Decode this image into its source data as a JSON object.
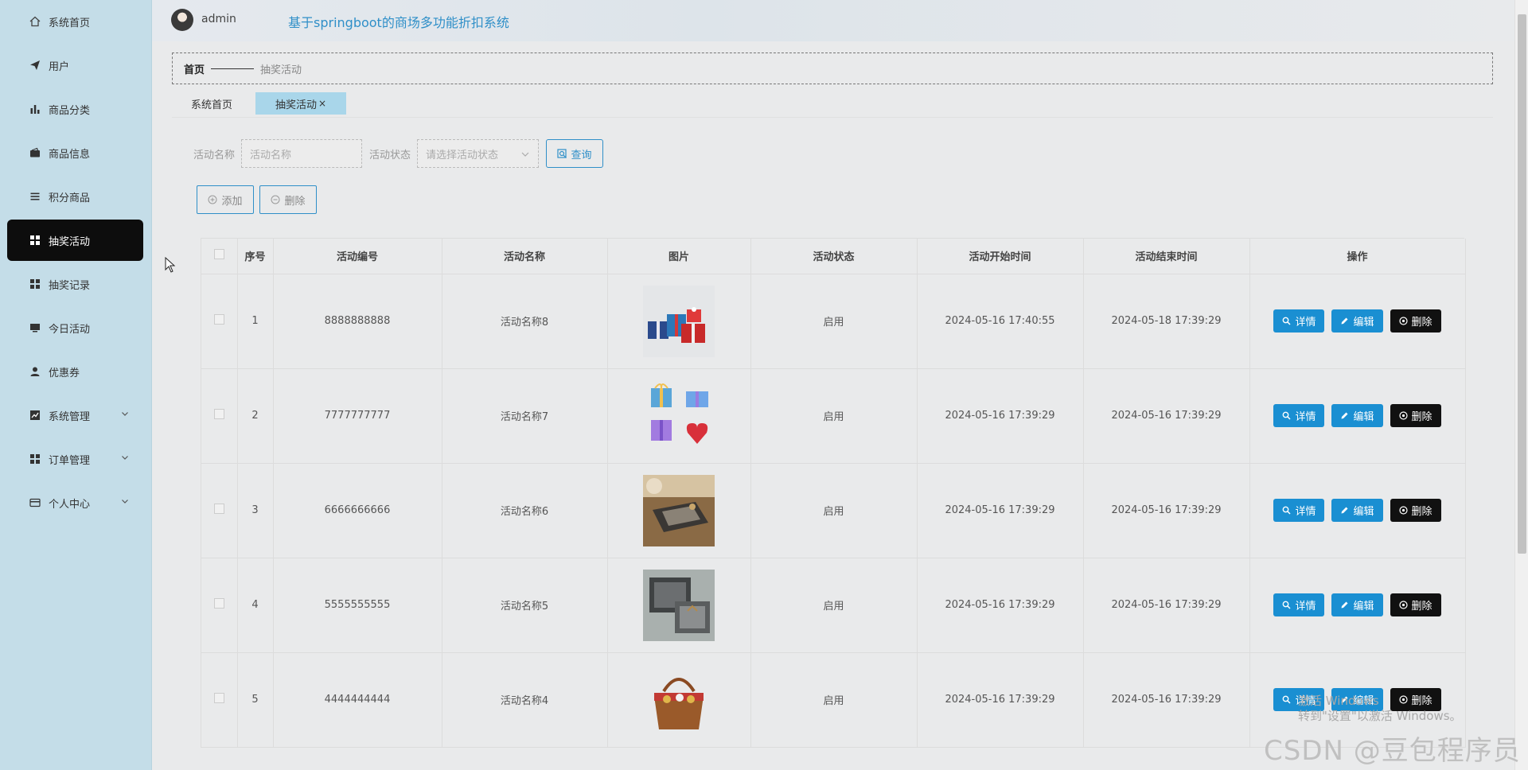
{
  "sidebar": {
    "items": [
      {
        "label": "系统首页",
        "icon": "home-icon"
      },
      {
        "label": "用户",
        "icon": "send-icon"
      },
      {
        "label": "商品分类",
        "icon": "bar-chart-icon"
      },
      {
        "label": "商品信息",
        "icon": "wallet-icon"
      },
      {
        "label": "积分商品",
        "icon": "list-icon"
      },
      {
        "label": "抽奖活动",
        "icon": "grid-icon",
        "active": true
      },
      {
        "label": "抽奖记录",
        "icon": "grid-icon"
      },
      {
        "label": "今日活动",
        "icon": "monitor-icon"
      },
      {
        "label": "优惠券",
        "icon": "user-icon"
      },
      {
        "label": "系统管理",
        "icon": "line-chart-icon",
        "expandable": true
      },
      {
        "label": "订单管理",
        "icon": "grid-icon",
        "expandable": true
      },
      {
        "label": "个人中心",
        "icon": "card-icon",
        "expandable": true
      }
    ]
  },
  "header": {
    "username": "admin",
    "title": "基于springboot的商场多功能折扣系统"
  },
  "breadcrumb": {
    "home": "首页",
    "current": "抽奖活动"
  },
  "tabs": [
    {
      "label": "系统首页"
    },
    {
      "label": "抽奖活动",
      "close": "×",
      "active": true
    }
  ],
  "search": {
    "name_label": "活动名称",
    "name_placeholder": "活动名称",
    "status_label": "活动状态",
    "status_placeholder": "请选择活动状态",
    "query_label": "查询"
  },
  "actions": {
    "add_label": "添加",
    "delete_label": "删除"
  },
  "table": {
    "columns": [
      "",
      "序号",
      "活动编号",
      "活动名称",
      "图片",
      "活动状态",
      "活动开始时间",
      "活动结束时间",
      "操作"
    ],
    "rows": [
      {
        "index": "1",
        "code": "8888888888",
        "name": "活动名称8",
        "status": "启用",
        "start": "2024-05-16 17:40:55",
        "end": "2024-05-18 17:39:29",
        "image": "gift-boxes-image"
      },
      {
        "index": "2",
        "code": "7777777777",
        "name": "活动名称7",
        "status": "启用",
        "start": "2024-05-16 17:39:29",
        "end": "2024-05-16 17:39:29",
        "image": "gift-icons-image"
      },
      {
        "index": "3",
        "code": "6666666666",
        "name": "活动名称6",
        "status": "启用",
        "start": "2024-05-16 17:39:29",
        "end": "2024-05-16 17:39:29",
        "image": "gift-box-table-image"
      },
      {
        "index": "4",
        "code": "5555555555",
        "name": "活动名称5",
        "status": "启用",
        "start": "2024-05-16 17:39:29",
        "end": "2024-05-16 17:39:29",
        "image": "gift-box-grey-image"
      },
      {
        "index": "5",
        "code": "4444444444",
        "name": "活动名称4",
        "status": "启用",
        "start": "2024-05-16 17:39:29",
        "end": "2024-05-16 17:39:29",
        "image": "gift-basket-image"
      }
    ],
    "op_detail": "详情",
    "op_edit": "编辑",
    "op_delete": "删除"
  },
  "watermark": {
    "windows_line1": "激活 Windows",
    "windows_line2": "转到\"设置\"以激活 Windows。",
    "csdn": "CSDN @豆包程序员"
  },
  "colors": {
    "sidebar_bg": "#c4dde8",
    "active_item": "#0d0d0d",
    "accent_blue": "#2f8fc8",
    "op_blue": "#1a8fd2",
    "op_dark": "#111111",
    "active_tab": "#a9d6ea"
  }
}
